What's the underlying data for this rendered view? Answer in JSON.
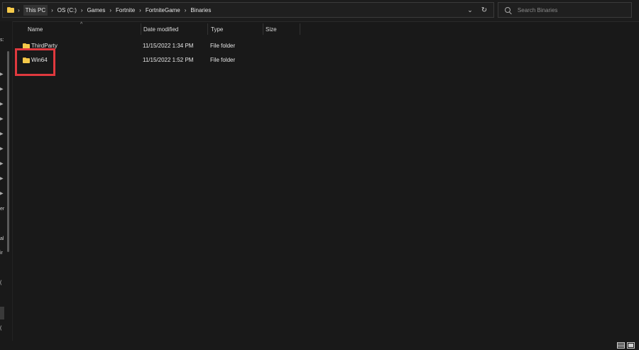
{
  "address_bar": {
    "crumbs": [
      "This PC",
      "OS (C:)",
      "Games",
      "Fortnite",
      "FortniteGame",
      "Binaries"
    ],
    "separator": "›",
    "dropdown_glyph": "⌄",
    "refresh_glyph": "↻"
  },
  "search": {
    "placeholder": "Search Binaries"
  },
  "columns": {
    "name": "Name",
    "date_modified": "Date modified",
    "type": "Type",
    "size": "Size",
    "sort_glyph": "^"
  },
  "files": [
    {
      "name": "ThirdParty",
      "date": "11/15/2022 1:34 PM",
      "type": "File folder",
      "icon": "folder-icon"
    },
    {
      "name": "Win64",
      "date": "11/15/2022 1:52 PM",
      "type": "File folder",
      "icon": "folder-icon"
    }
  ],
  "nav_fragments": [
    "s:",
    "er",
    "al",
    "ir",
    "(",
    "("
  ],
  "highlight_color": "#e0393e",
  "folder_color": "#f5c94a"
}
